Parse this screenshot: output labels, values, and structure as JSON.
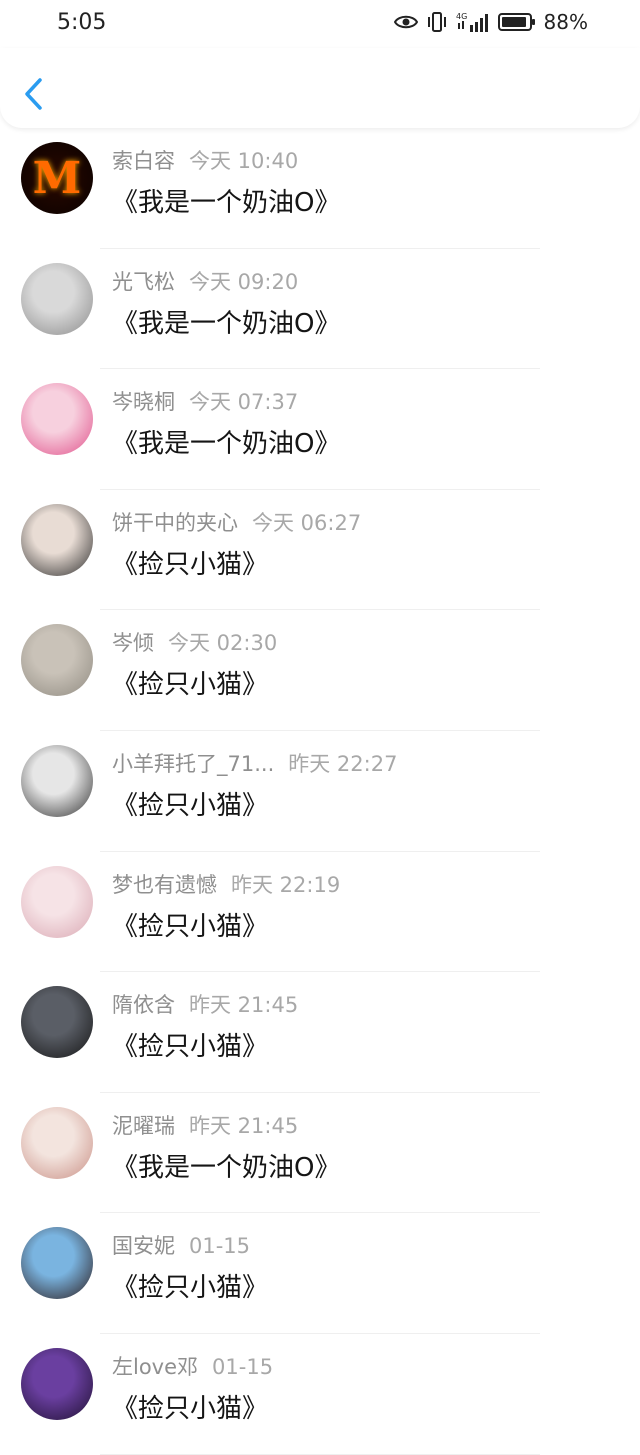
{
  "status_bar": {
    "time": "5:05",
    "battery": "88%",
    "network": "4G"
  },
  "header": {
    "back_icon": "chevron-left-icon",
    "accent": "#2a9cf0"
  },
  "items": [
    {
      "name": "索白容",
      "time": "今天 10:40",
      "title": "《我是一个奶油O》",
      "avatar_colors": [
        "#3a0a02",
        "#ff6a00"
      ],
      "avatar_letter": "M"
    },
    {
      "name": "光飞松",
      "time": "今天 09:20",
      "title": "《我是一个奶油O》",
      "avatar_colors": [
        "#d9d9d9",
        "#8a8a8a"
      ],
      "avatar_letter": ""
    },
    {
      "name": "岑晓桐",
      "time": "今天 07:37",
      "title": "《我是一个奶油O》",
      "avatar_colors": [
        "#f7d0de",
        "#e0508a"
      ],
      "avatar_letter": ""
    },
    {
      "name": "饼干中的夹心",
      "time": "今天 06:27",
      "title": "《捡只小猫》",
      "avatar_colors": [
        "#e8dcd4",
        "#2a2a2a"
      ],
      "avatar_letter": ""
    },
    {
      "name": "岑倾",
      "time": "今天 02:30",
      "title": "《捡只小猫》",
      "avatar_colors": [
        "#c9c2b8",
        "#8f8a80"
      ],
      "avatar_letter": ""
    },
    {
      "name": "小羊拜托了_71...",
      "time": "昨天 22:27",
      "title": "《捡只小猫》",
      "avatar_colors": [
        "#e6e6e6",
        "#303030"
      ],
      "avatar_letter": ""
    },
    {
      "name": "梦也有遗憾",
      "time": "昨天 22:19",
      "title": "《捡只小猫》",
      "avatar_colors": [
        "#f6e3e6",
        "#d9a7b2"
      ],
      "avatar_letter": ""
    },
    {
      "name": "隋依含",
      "time": "昨天 21:45",
      "title": "《捡只小猫》",
      "avatar_colors": [
        "#5a5e66",
        "#141414"
      ],
      "avatar_letter": ""
    },
    {
      "name": "泥曜瑞",
      "time": "昨天 21:45",
      "title": "《我是一个奶油O》",
      "avatar_colors": [
        "#f3e4de",
        "#c98f85"
      ],
      "avatar_letter": ""
    },
    {
      "name": "国安妮",
      "time": "01-15",
      "title": "《捡只小猫》",
      "avatar_colors": [
        "#7ab4e0",
        "#2a1a1a"
      ],
      "avatar_letter": ""
    },
    {
      "name": "左love邓",
      "time": "01-15",
      "title": "《捡只小猫》",
      "avatar_colors": [
        "#6a3fa0",
        "#1e1030"
      ],
      "avatar_letter": ""
    }
  ]
}
